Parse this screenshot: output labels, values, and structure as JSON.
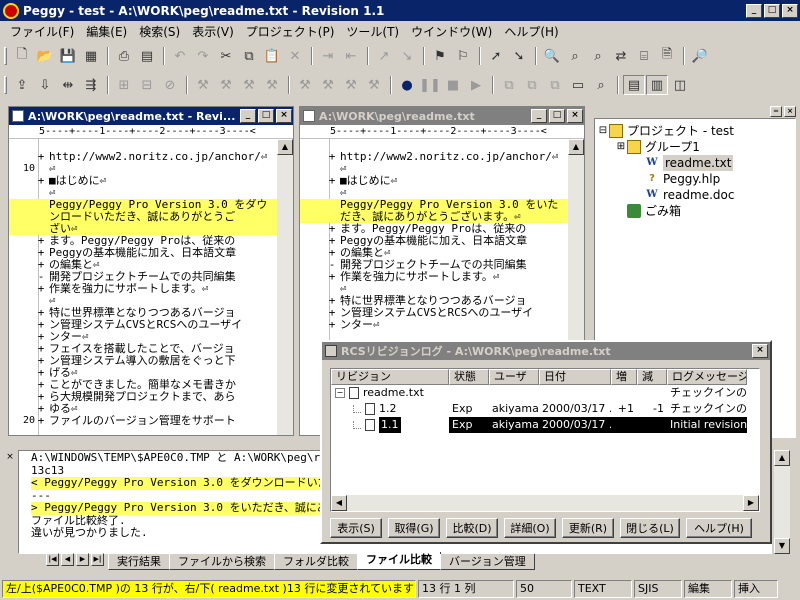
{
  "window": {
    "title": "Peggy - test - A:\\WORK\\peg\\readme.txt - Revision 1.1",
    "caption_buttons": [
      "_",
      "□",
      "×"
    ]
  },
  "menu": [
    "ファイル(F)",
    "編集(E)",
    "検索(S)",
    "表示(V)",
    "プロジェクト(P)",
    "ツール(T)",
    "ウインドウ(W)",
    "ヘルプ(H)"
  ],
  "editor_left": {
    "title": "A:\\WORK\\peg\\readme.txt - Revi...",
    "ruler": "5----+----1----+----2----+----3----<",
    "lines": [
      {
        "no": "",
        "mark": "",
        "text": "",
        "hl": false
      },
      {
        "no": "",
        "mark": "+",
        "text": "http://www2.noritz.co.jp/anchor/⏎",
        "hl": false
      },
      {
        "no": "10",
        "mark": "",
        "text": "⏎",
        "hl": false
      },
      {
        "no": "",
        "mark": "+",
        "text": "■はじめに⏎",
        "hl": false
      },
      {
        "no": "",
        "mark": "",
        "text": "⏎",
        "hl": false
      },
      {
        "no": "",
        "mark": "",
        "text": "Peggy/Peggy Pro Version 3.0 をダウ",
        "hl": true
      },
      {
        "no": "",
        "mark": "",
        "text": "ンロードいただき、誠にありがとうご",
        "hl": true
      },
      {
        "no": "",
        "mark": "",
        "text": "ざい⏎",
        "hl": true
      },
      {
        "no": "",
        "mark": "+",
        "text": "ます。Peggy/Peggy Proは、従来の",
        "hl": false
      },
      {
        "no": "",
        "mark": "+",
        "text": "Peggyの基本機能に加え、日本語文章",
        "hl": false
      },
      {
        "no": "",
        "mark": "+",
        "text": "の編集と⏎",
        "hl": false
      },
      {
        "no": "",
        "mark": "-",
        "text": "開発プロジェクトチームでの共同編集",
        "hl": false
      },
      {
        "no": "",
        "mark": "+",
        "text": "作業を強力にサポートします。⏎",
        "hl": false
      },
      {
        "no": "",
        "mark": "",
        "text": "⏎",
        "hl": false
      },
      {
        "no": "",
        "mark": "+",
        "text": "特に世界標準となりつつあるバージョ",
        "hl": false
      },
      {
        "no": "",
        "mark": "+",
        "text": "ン管理システムCVSとRCSへのユーザイ",
        "hl": false
      },
      {
        "no": "",
        "mark": "+",
        "text": "ンター⏎",
        "hl": false
      },
      {
        "no": "",
        "mark": "+",
        "text": "フェイスを搭載したことで、バージョ",
        "hl": false
      },
      {
        "no": "",
        "mark": "+",
        "text": "ン管理システム導入の敷居をぐっと下",
        "hl": false
      },
      {
        "no": "",
        "mark": "+",
        "text": "げる⏎",
        "hl": false
      },
      {
        "no": "",
        "mark": "+",
        "text": "ことができました。簡単なメモ書きか",
        "hl": false
      },
      {
        "no": "",
        "mark": "+",
        "text": "ら大規模開発プロジェクトまで、あら",
        "hl": false
      },
      {
        "no": "",
        "mark": "+",
        "text": "ゆる⏎",
        "hl": false
      },
      {
        "no": "20",
        "mark": "+",
        "text": "ファイルのバージョン管理をサポート",
        "hl": false
      }
    ]
  },
  "editor_right": {
    "title": "A:\\WORK\\peg\\readme.txt",
    "ruler": "5----+----1----+----2----+----3----<",
    "lines": [
      {
        "no": "",
        "mark": "",
        "text": "",
        "hl": false
      },
      {
        "no": "",
        "mark": "+",
        "text": "http://www2.noritz.co.jp/anchor/⏎",
        "hl": false
      },
      {
        "no": "",
        "mark": "",
        "text": "⏎",
        "hl": false
      },
      {
        "no": "",
        "mark": "+",
        "text": "■はじめに⏎",
        "hl": false
      },
      {
        "no": "",
        "mark": "",
        "text": "⏎",
        "hl": false
      },
      {
        "no": "",
        "mark": "",
        "text": "Peggy/Peggy Pro Version 3.0 をいた",
        "hl": true
      },
      {
        "no": "",
        "mark": "",
        "text": "だき、誠にありがとうございます。⏎",
        "hl": true
      },
      {
        "no": "",
        "mark": "+",
        "text": "ます。Peggy/Peggy Proは、従来の",
        "hl": false
      },
      {
        "no": "",
        "mark": "+",
        "text": "Peggyの基本機能に加え、日本語文章",
        "hl": false
      },
      {
        "no": "",
        "mark": "+",
        "text": "の編集と⏎",
        "hl": false
      },
      {
        "no": "",
        "mark": "-",
        "text": "開発プロジェクトチームでの共同編集",
        "hl": false
      },
      {
        "no": "",
        "mark": "+",
        "text": "作業を強力にサポートします。⏎",
        "hl": false
      },
      {
        "no": "",
        "mark": "",
        "text": "⏎",
        "hl": false
      },
      {
        "no": "",
        "mark": "+",
        "text": "特に世界標準となりつつあるバージョ",
        "hl": false
      },
      {
        "no": "",
        "mark": "+",
        "text": "ン管理システムCVSとRCSへのユーザイ",
        "hl": false
      },
      {
        "no": "",
        "mark": "+",
        "text": "ンター⏎",
        "hl": false
      }
    ]
  },
  "project_tree": [
    {
      "label": "プロジェクト - test",
      "icon": "project-icon",
      "indent": 0,
      "expander": "⊟"
    },
    {
      "label": "グループ1",
      "icon": "folder-icon",
      "indent": 1,
      "expander": "⊞"
    },
    {
      "label": "readme.txt",
      "icon": "word-doc-icon",
      "indent": 2,
      "expander": "",
      "selected": true
    },
    {
      "label": "Peggy.hlp",
      "icon": "help-file-icon",
      "indent": 2,
      "expander": ""
    },
    {
      "label": "readme.doc",
      "icon": "word-doc-icon",
      "indent": 2,
      "expander": ""
    },
    {
      "label": "ごみ箱",
      "icon": "trash-icon",
      "indent": 1,
      "expander": ""
    }
  ],
  "output": {
    "lines": [
      {
        "text": "A:\\WINDOWS\\TEMP\\$APE0C0.TMP と A:\\WORK\\peg\\readme...",
        "hl": false
      },
      {
        "text": "13c13",
        "hl": false
      },
      {
        "text": "< Peggy/Peggy Pro Version 3.0 をダウンロードいただ...",
        "hl": true
      },
      {
        "text": "---",
        "hl": false
      },
      {
        "text": "> Peggy/Peggy Pro Version 3.0 をいただき、誠にあ...",
        "hl": true
      },
      {
        "text": "ファイル比較終了.",
        "hl": false
      },
      {
        "text": "違いが見つかりました.",
        "hl": false
      }
    ],
    "tabs": [
      "実行結果",
      "ファイルから検索",
      "フォルダ比較",
      "ファイル比較",
      "バージョン管理"
    ],
    "active_tab": "ファイル比較"
  },
  "rcs_dialog": {
    "title": "RCSリビジョンログ - A:\\WORK\\peg\\readme.txt",
    "columns": [
      "リビジョン",
      "状態",
      "ユーザ",
      "日付",
      "増",
      "減",
      "ログメッセージ"
    ],
    "rows": [
      {
        "rev": "readme.txt",
        "state": "",
        "user": "",
        "date": "",
        "add": "",
        "del": "",
        "msg": "チェックインのテ",
        "level": 0,
        "selected": false
      },
      {
        "rev": "1.2",
        "state": "Exp",
        "user": "akiyama",
        "date": "2000/03/17 ...",
        "add": "+1",
        "del": "-1",
        "msg": "チェックインのテ",
        "level": 1,
        "selected": false
      },
      {
        "rev": "1.1",
        "state": "Exp",
        "user": "akiyama",
        "date": "2000/03/17 ...",
        "add": "",
        "del": "",
        "msg": "Initial revision",
        "level": 1,
        "selected": true
      }
    ],
    "buttons": [
      "表示(S)",
      "取得(G)",
      "比較(D)",
      "詳細(O)",
      "更新(R)",
      "閉じる(L)",
      "ヘルプ(H)"
    ]
  },
  "status_bar": {
    "message": "左/上($APE0C0.TMP )の 13 行が、右/下( readme.txt )13 行に変更されています.",
    "position": "13 行 1 列",
    "zoom": "50",
    "mode": "TEXT",
    "encoding": "SJIS",
    "edit_mode": "編集",
    "insert": "挿入"
  },
  "colors": {
    "titlebar_active": "#0a246a",
    "titlebar_inactive": "#808080",
    "diff_highlight": "#ffff66",
    "status_highlight": "#ffff00"
  }
}
